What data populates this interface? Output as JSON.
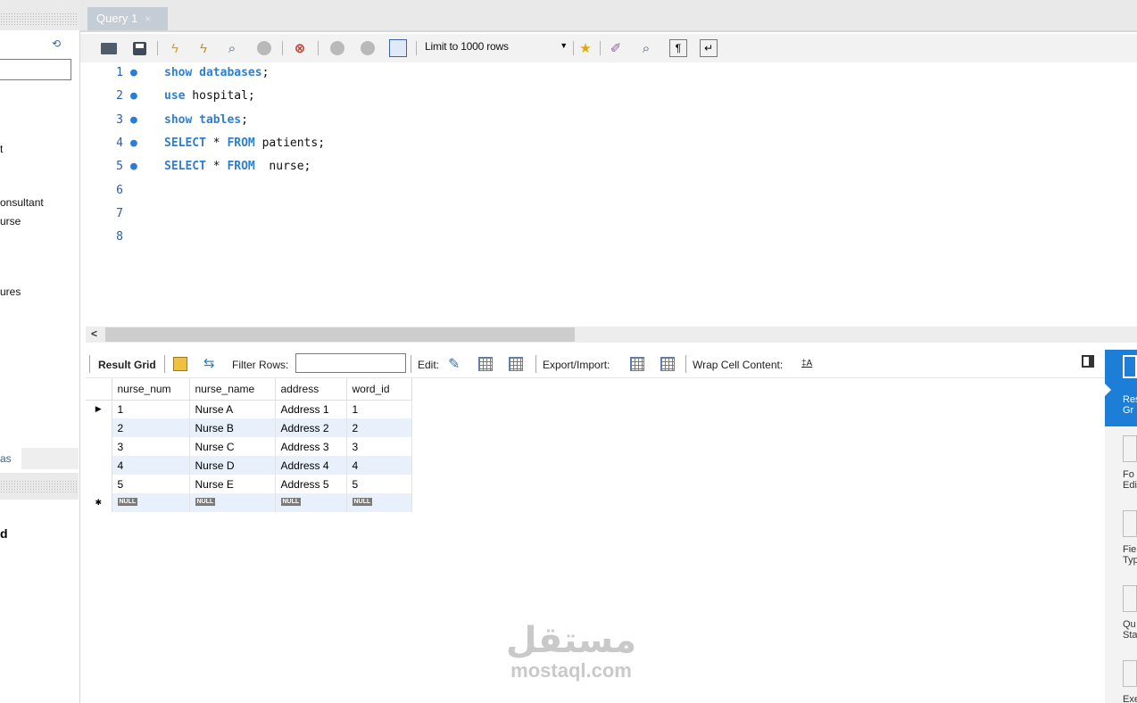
{
  "query_tab": {
    "title": "Query 1",
    "close": "×"
  },
  "toolbar": {
    "limit_label": "Limit to 1000 rows"
  },
  "editor": {
    "lines": [
      {
        "num": "1",
        "tokens": [
          {
            "t": "show databases",
            "kw": true
          },
          {
            "t": ";",
            "kw": false
          }
        ]
      },
      {
        "num": "2",
        "tokens": [
          {
            "t": "use",
            "kw": true
          },
          {
            "t": " hospital;",
            "kw": false
          }
        ]
      },
      {
        "num": "3",
        "tokens": [
          {
            "t": "show tables",
            "kw": true
          },
          {
            "t": ";",
            "kw": false
          }
        ]
      },
      {
        "num": "4",
        "tokens": [
          {
            "t": "SELECT",
            "kw": true
          },
          {
            "t": " * ",
            "kw": false
          },
          {
            "t": "FROM",
            "kw": true
          },
          {
            "t": " patients;",
            "kw": false
          }
        ]
      },
      {
        "num": "5",
        "tokens": [
          {
            "t": "SELECT",
            "kw": true
          },
          {
            "t": " * ",
            "kw": false
          },
          {
            "t": "FROM",
            "kw": true
          },
          {
            "t": "  nurse;",
            "kw": false
          }
        ]
      },
      {
        "num": "6",
        "tokens": []
      },
      {
        "num": "7",
        "tokens": []
      },
      {
        "num": "8",
        "tokens": []
      }
    ]
  },
  "result_toolbar": {
    "result_grid": "Result Grid",
    "filter_rows": "Filter Rows:",
    "edit": "Edit:",
    "export_import": "Export/Import:",
    "wrap_cell": "Wrap Cell Content:"
  },
  "grid": {
    "columns": [
      "nurse_num",
      "nurse_name",
      "address",
      "word_id"
    ],
    "rows": [
      [
        "1",
        "Nurse A",
        "Address 1",
        "1"
      ],
      [
        "2",
        "Nurse B",
        "Address 2",
        "2"
      ],
      [
        "3",
        "Nurse C",
        "Address 3",
        "3"
      ],
      [
        "4",
        "Nurse D",
        "Address 4",
        "4"
      ],
      [
        "5",
        "Nurse E",
        "Address 5",
        "5"
      ]
    ],
    "null_label": "NULL",
    "current_row_marker": "▶",
    "new_row_marker": "✱"
  },
  "left_panel": {
    "tree_items": [
      "t",
      "onsultant",
      "urse",
      "ures"
    ],
    "bottom_tab": "as",
    "info_bold": "d"
  },
  "right_panel": {
    "items": [
      {
        "label": "Res\nGr",
        "active": true
      },
      {
        "label": "Fo\nEdi",
        "active": false
      },
      {
        "label": "Fie\nTyp",
        "active": false
      },
      {
        "label": "Qu\nSta",
        "active": false
      },
      {
        "label": "Exec",
        "active": false
      }
    ]
  },
  "watermark": {
    "arabic": "مستقل",
    "latin": "mostaql.com"
  },
  "colors": {
    "keyword": "#2f7fcf",
    "accent": "#1c7ed6",
    "alt_row": "#e8f0fb"
  }
}
